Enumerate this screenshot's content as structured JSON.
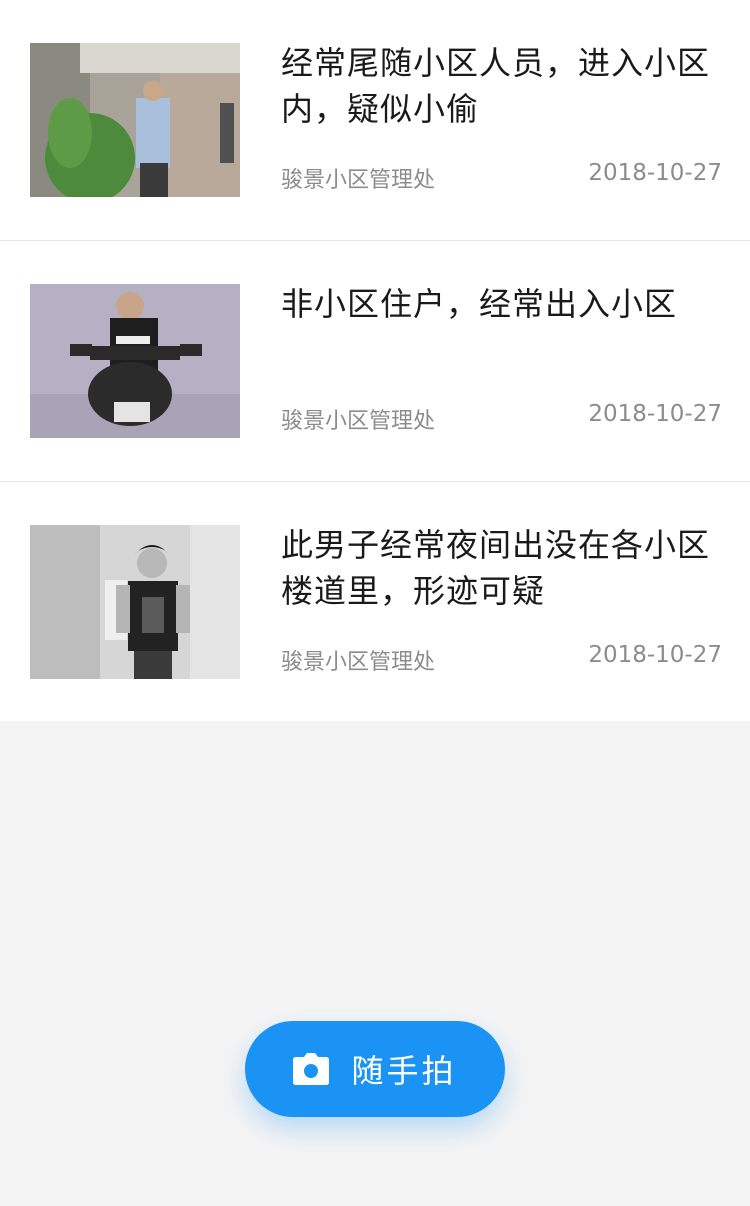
{
  "posts": [
    {
      "title": "经常尾随小区人员，进入小区内，疑似小偷",
      "source": "骏景小区管理处",
      "date": "2018-10-27"
    },
    {
      "title": "非小区住户，经常出入小区",
      "source": "骏景小区管理处",
      "date": "2018-10-27"
    },
    {
      "title": "此男子经常夜间出没在各小区楼道里，形迹可疑",
      "source": "骏景小区管理处",
      "date": "2018-10-27"
    }
  ],
  "fab": {
    "label": "随手拍",
    "icon": "camera-icon",
    "color": "#1a93f5"
  }
}
